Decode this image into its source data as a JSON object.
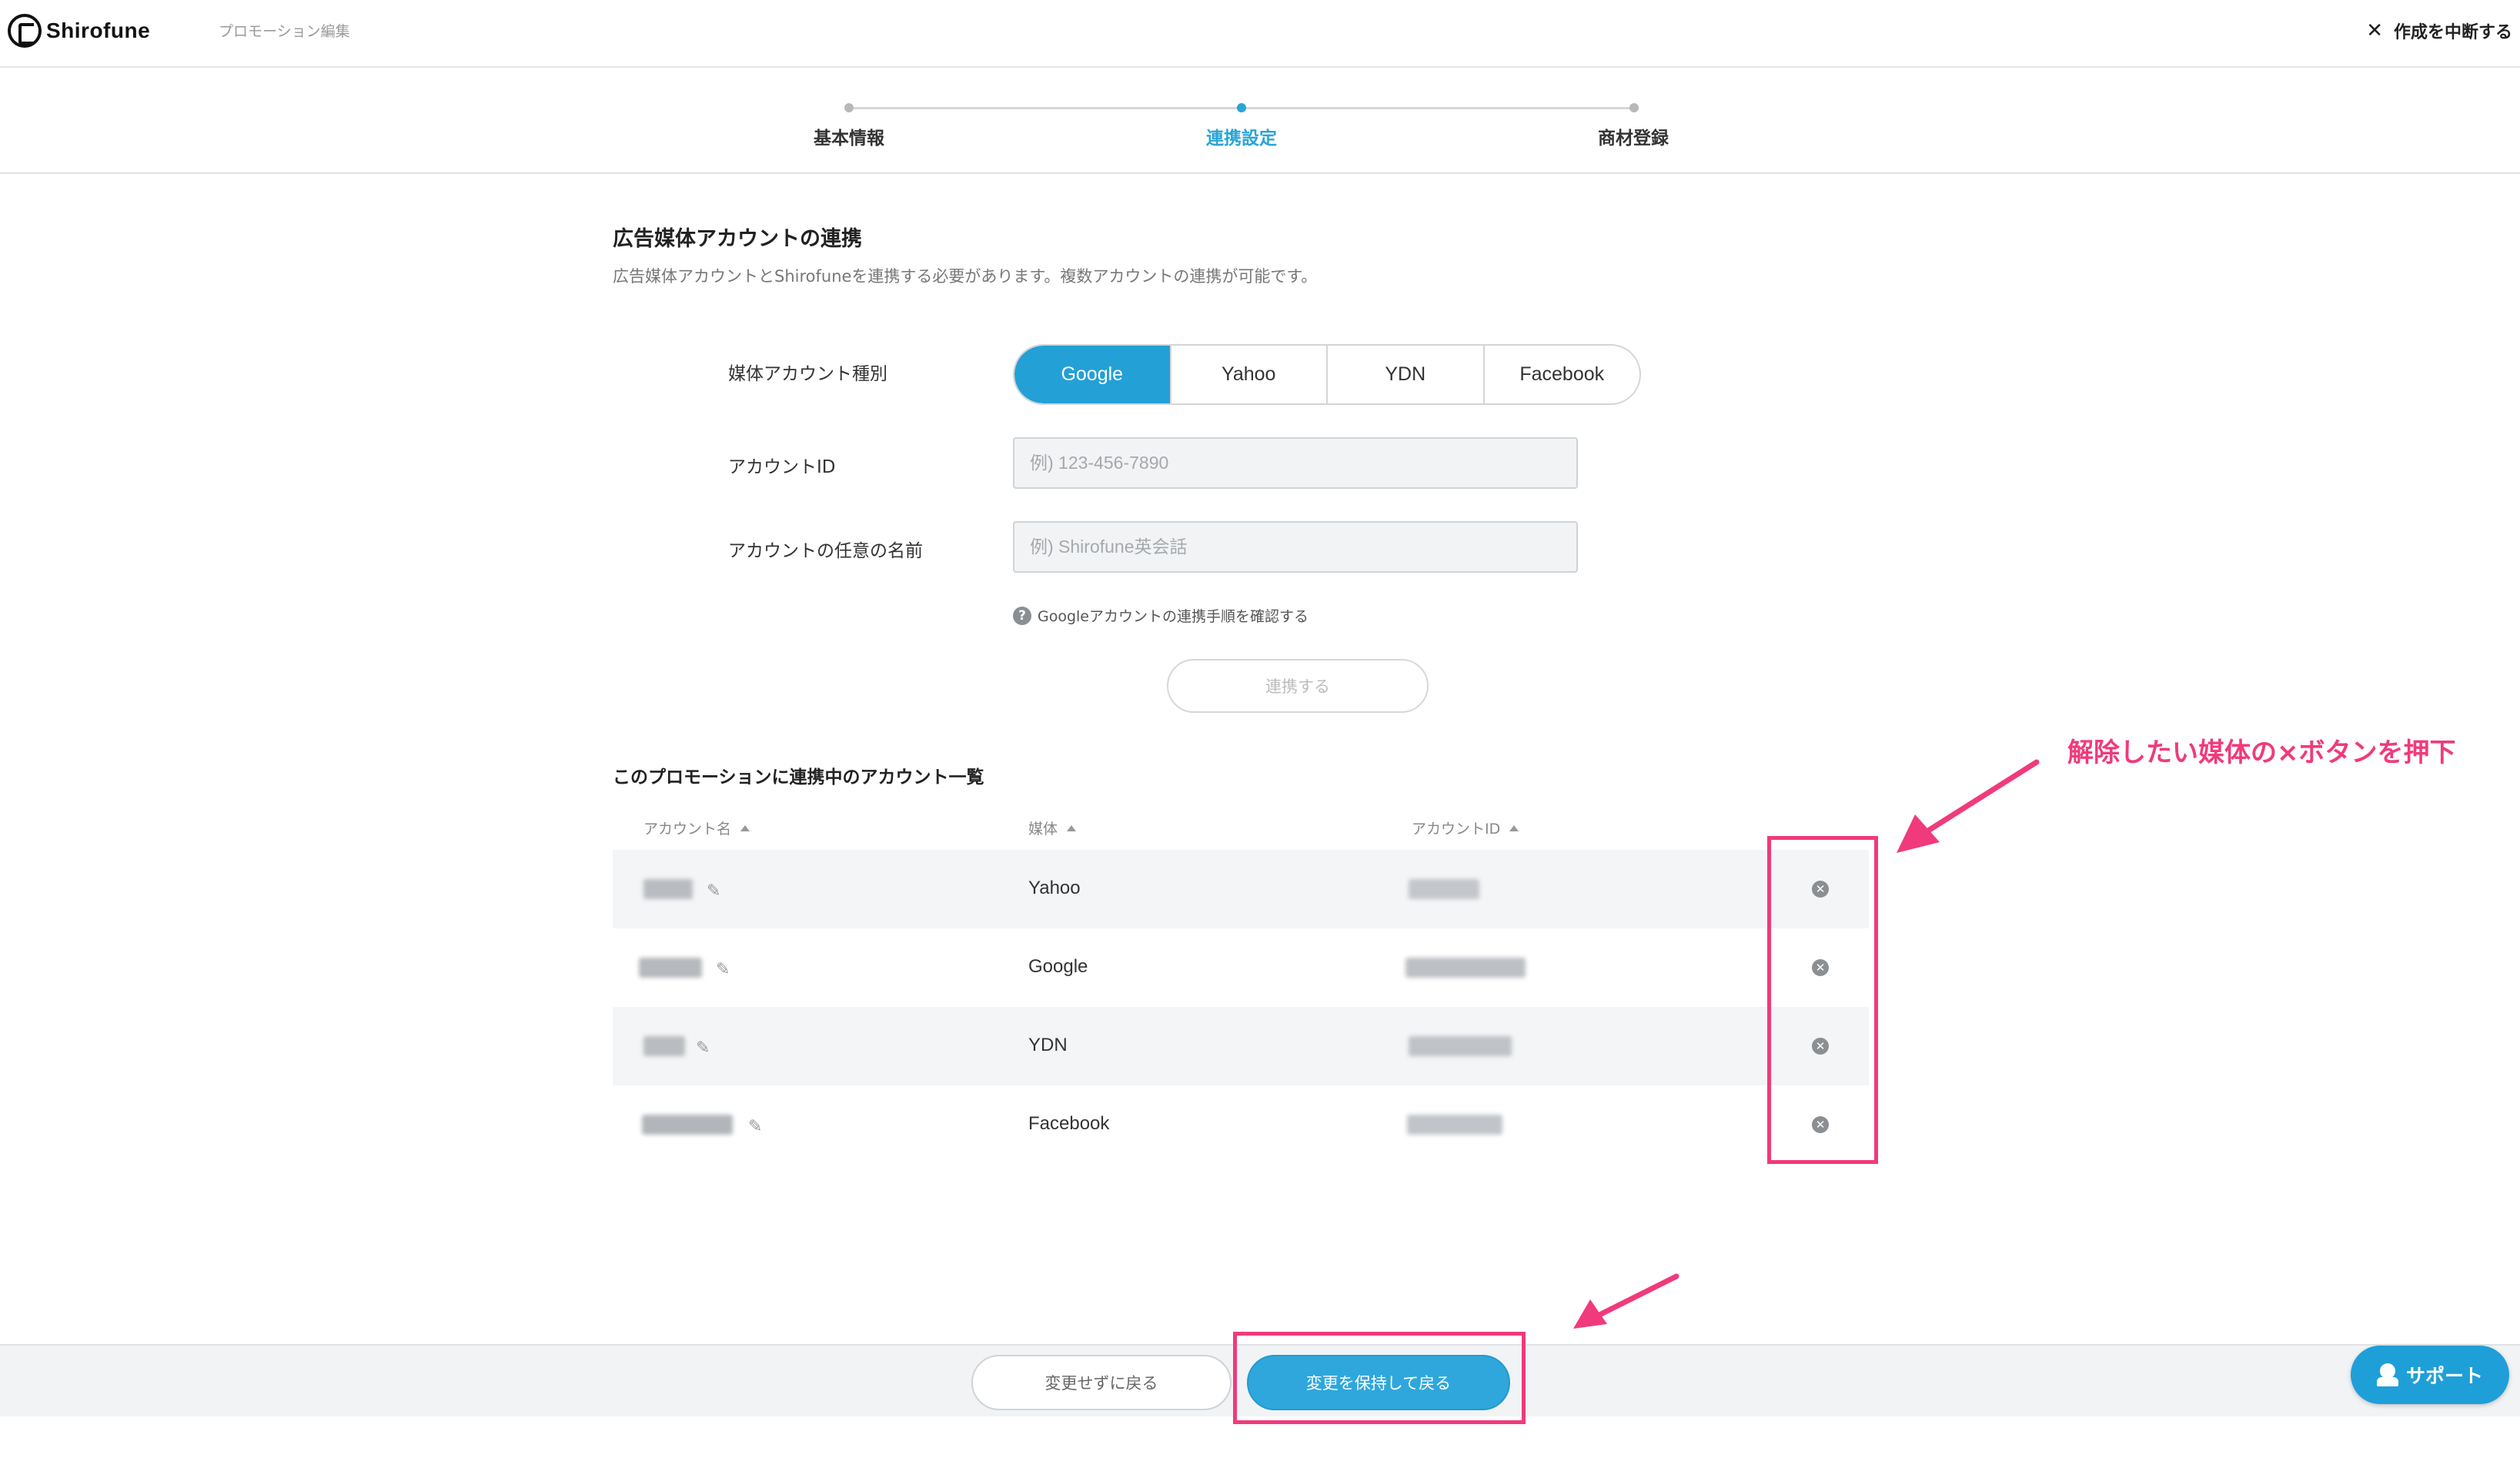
{
  "header": {
    "logo_text": "Shirofune",
    "subtitle": "プロモーション編集",
    "cancel_label": "作成を中断する"
  },
  "stepper": {
    "steps": [
      {
        "label": "基本情報",
        "active": false
      },
      {
        "label": "連携設定",
        "active": true
      },
      {
        "label": "商材登録",
        "active": false
      }
    ]
  },
  "section": {
    "title": "広告媒体アカウントの連携",
    "description": "広告媒体アカウントとShirofuneを連携する必要があります。複数アカウントの連携が可能です。"
  },
  "form": {
    "media_type_label": "媒体アカウント種別",
    "media_options": [
      "Google",
      "Yahoo",
      "YDN",
      "Facebook"
    ],
    "selected_media": "Google",
    "account_id_label": "アカウントID",
    "account_id_placeholder": "例) 123-456-7890",
    "account_name_label": "アカウントの任意の名前",
    "account_name_placeholder": "例) Shirofune英会話",
    "help_text": "Googleアカウントの連携手順を確認する",
    "link_button": "連携する"
  },
  "accounts": {
    "title": "このプロモーションに連携中のアカウント一覧",
    "columns": [
      "アカウント名",
      "媒体",
      "アカウントID"
    ],
    "rows": [
      {
        "media": "Yahoo"
      },
      {
        "media": "Google"
      },
      {
        "media": "YDN"
      },
      {
        "media": "Facebook"
      }
    ]
  },
  "annotation": {
    "text": "解除したい媒体の×ボタンを押下",
    "color": "#f03a7c"
  },
  "footer": {
    "back_label": "変更せずに戻る",
    "save_label": "変更を保持して戻る"
  },
  "support": {
    "label": "サポート"
  },
  "colors": {
    "accent": "#23a0d6",
    "highlight": "#f03a7c"
  }
}
